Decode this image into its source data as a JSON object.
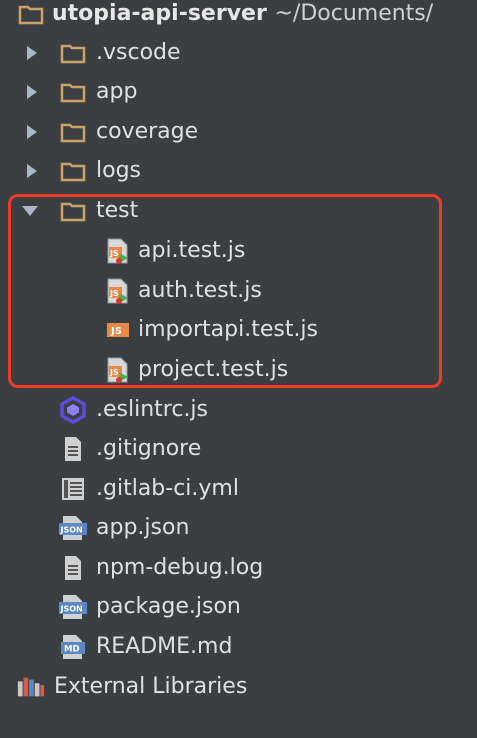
{
  "project": {
    "name": "utopia-api-server",
    "path": "~/Documents/"
  },
  "tree": {
    "folders": [
      {
        "label": ".vscode"
      },
      {
        "label": "app"
      },
      {
        "label": "coverage"
      },
      {
        "label": "logs"
      },
      {
        "label": "test"
      }
    ],
    "test_files": [
      {
        "label": "api.test.js"
      },
      {
        "label": "auth.test.js"
      },
      {
        "label": "importapi.test.js"
      },
      {
        "label": "project.test.js"
      }
    ],
    "files": [
      {
        "label": ".eslintrc.js",
        "icon": "eslint-icon"
      },
      {
        "label": ".gitignore",
        "icon": "text-file-icon"
      },
      {
        "label": ".gitlab-ci.yml",
        "icon": "yaml-file-icon"
      },
      {
        "label": "app.json",
        "icon": "json-file-icon",
        "badge": "JSON"
      },
      {
        "label": "npm-debug.log",
        "icon": "text-file-icon"
      },
      {
        "label": "package.json",
        "icon": "json-file-icon",
        "badge": "JSON"
      },
      {
        "label": "README.md",
        "icon": "markdown-file-icon",
        "badge": "MD"
      }
    ],
    "external": {
      "label": "External Libraries"
    }
  },
  "icons": {
    "js_badge": "JS"
  },
  "colors": {
    "background": "#3c3f41",
    "folder": "#c9a26a",
    "highlight_border": "#f03a2a",
    "js_file": "#e8894a",
    "json_badge": "#5c86c4",
    "eslint": "#5b4ddb"
  }
}
